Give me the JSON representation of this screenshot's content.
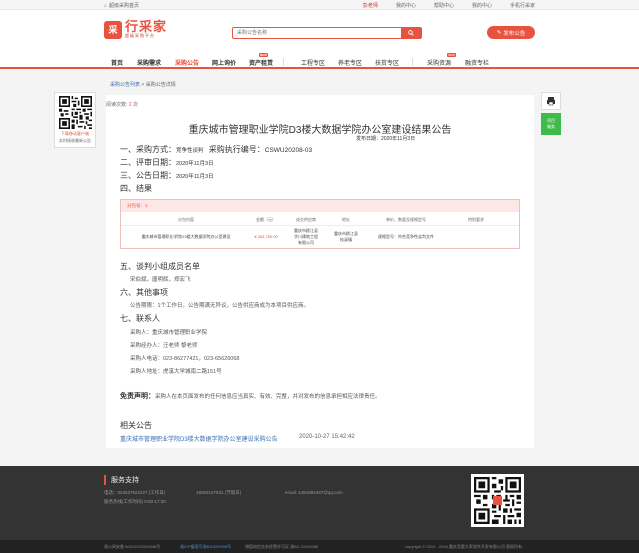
{
  "topbar": {
    "home": "超级采购首页",
    "user": "彭老师",
    "links": [
      "我的中心",
      "帮助中心",
      "我的中心",
      "手机行采家"
    ]
  },
  "header": {
    "logo_mark": "采",
    "logo_main": "行采家",
    "logo_sub": "超级采购平台",
    "search_placeholder": "采购公告名称",
    "publish_label": "发布公告"
  },
  "nav": {
    "items": [
      "首页",
      "采购需求",
      "采购公告",
      "网上询价",
      "资产租赁",
      "工程专区",
      "养老专区",
      "扶贫专区",
      "采购资源",
      "融资专栏"
    ],
    "badge": "NEW"
  },
  "breadcrumb": {
    "link": "采购公告列表",
    "sep": ">",
    "current": "采购公告详情"
  },
  "left_qr": {
    "line1": "下载移动客户端",
    "line2": "实时接收最新公告"
  },
  "article": {
    "reads_label": "阅读次数:",
    "reads_value": "2",
    "reads_unit": "次",
    "title": "重庆城市管理职业学院D3楼大数据学院办公室建设结果公告",
    "pub_date": "发布日期：2020年11月3日",
    "s1_label": "一、采购方式：",
    "s1_value": "竞争性谈判",
    "s1_code_label": "采购执行编号：",
    "s1_code": "CSWU20208-03",
    "s2_label": "二、评审日期：",
    "s2_value": "2020年11月3日",
    "s3_label": "三、公告日期：",
    "s3_value": "2020年11月3日",
    "s4_label": "四、结果",
    "table": {
      "pkg": "分包号：1",
      "headers": [
        "分包内容",
        "金额（元）",
        "成交供应商",
        "地址",
        "单价、数量及规格型号",
        "特别要求"
      ],
      "row": {
        "content": "重庆城市管理职业学院D3楼大数据学院办公室建设",
        "amount": "¥ 263,780.00",
        "supplier": [
          "重庆市欧江县",
          "华川建筑工程",
          "有限公司"
        ],
        "address": [
          "重庆市欧江县",
          "桂溪镇"
        ],
        "spec": "规格型号：符合竞争性谈判文件"
      }
    },
    "s5_label": "五、谈判小组成员名单",
    "s5_value": "宋伯斌，唐明辉，郑宏飞",
    "s6_label": "六、其他事项",
    "s6_value": "公告期限：1个工作日，公告期满无异议，公告供应商成为本项目供应商。",
    "s7_label": "七、联系人",
    "contacts": [
      "采购人：重庆城市管理职业学院",
      "采购经办人：汪老师 黎老师",
      "采购人电话：023-86277421，023-65626068",
      "采购人地址：虎溪大学城南二路151号"
    ],
    "disclaimer_label": "免责声明：",
    "disclaimer_text": "采购人在本页面发布的任何信息应当真实、有效、完整，并对发布的信息承担相应法律责任。",
    "related_label": "相关公告",
    "related_link": "重庆城市管理职业学院D3楼大数据学院办公室建设采购公告",
    "related_date": "2020-10-27 15:42:42"
  },
  "side": {
    "green_line1": "项目",
    "green_line2": "服务"
  },
  "footer": {
    "title": "服务支持",
    "phone": "电话：023637922227 (工作日)",
    "phone2": "18083107831 (节假日)",
    "email": "email: 1481694487@qq.com",
    "time": "服务热线(工作时间) 9:00-17:30",
    "bottom_left": "渝公网安备 50010202000046号",
    "bottom_icp": "渝ICP备案号渝B10090908号",
    "bottom_mid": "增值电信业务经营许可证 渝B2-20190085",
    "bottom_right": "copyright © 2010 - 2018 重庆竞惠大家软件开发有限公司 版权所有"
  }
}
